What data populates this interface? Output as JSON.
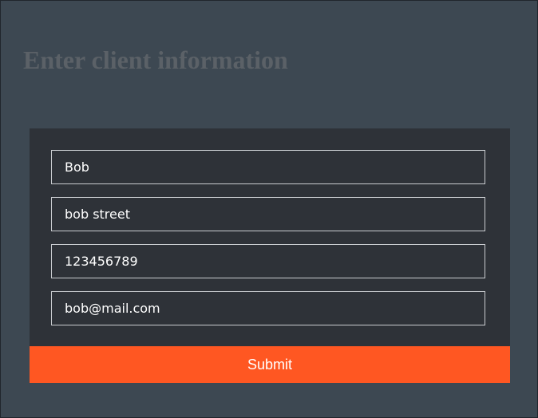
{
  "page": {
    "title": "Enter client information"
  },
  "form": {
    "fields": [
      {
        "name": "name",
        "value": "Bob"
      },
      {
        "name": "address",
        "value": "bob street"
      },
      {
        "name": "phone",
        "value": "123456789"
      },
      {
        "name": "email",
        "value": "bob@mail.com"
      }
    ],
    "submit_label": "Submit"
  },
  "colors": {
    "background": "#3d4852",
    "card": "#2e3238",
    "accent": "#ff5722",
    "title": "#5b6167",
    "field_border": "#c9ccd0"
  }
}
